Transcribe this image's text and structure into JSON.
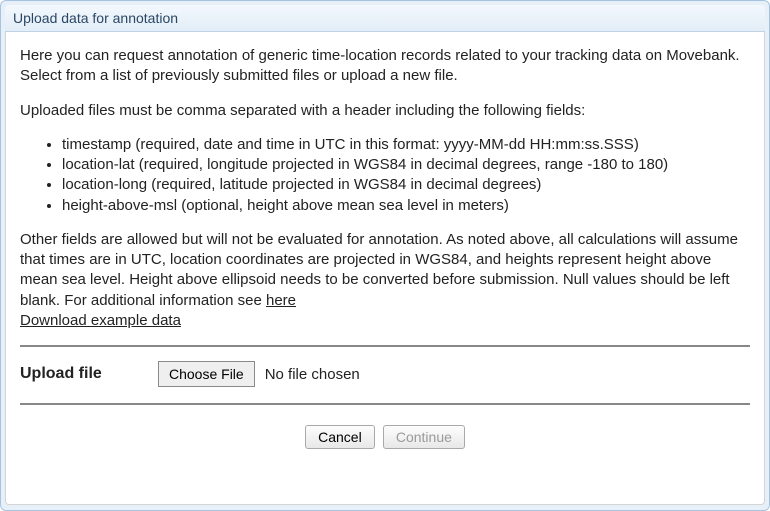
{
  "dialog": {
    "title": "Upload data for annotation"
  },
  "intro": {
    "p1": "Here you can request annotation of generic time-location records related to your tracking data on Movebank. Select from a list of previously submitted files or upload a new file.",
    "p2": "Uploaded files must be comma separated with a header including the following fields:"
  },
  "fields": {
    "f1": "timestamp (required, date and time in UTC in this format: yyyy-MM-dd HH:mm:ss.SSS)",
    "f2": "location-lat (required, longitude projected in WGS84 in decimal degrees, range -180 to 180)",
    "f3": "location-long (required, latitude projected in WGS84 in decimal degrees)",
    "f4": "height-above-msl (optional, height above mean sea level in meters)"
  },
  "notes": {
    "p3a": "Other fields are allowed but will not be evaluated for annotation. As noted above, all calculations will assume that times are in UTC, location coordinates are projected in WGS84, and heights represent height above mean sea level. Height above ellipsoid needs to be converted before submission. Null values should be left blank. For additional information see ",
    "here_link": "here",
    "download_link": "Download example data"
  },
  "upload": {
    "label": "Upload file",
    "choose_button": "Choose File",
    "status": "No file chosen"
  },
  "actions": {
    "cancel": "Cancel",
    "continue": "Continue"
  }
}
